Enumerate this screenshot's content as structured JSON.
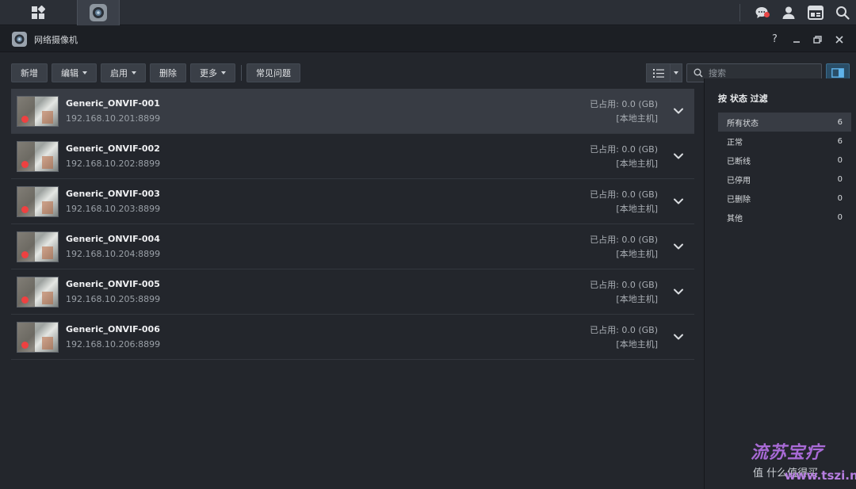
{
  "window": {
    "title": "网络摄像机"
  },
  "toolbar": {
    "add": "新增",
    "edit": "编辑",
    "enable": "启用",
    "delete": "删除",
    "more": "更多",
    "faq": "常见问题"
  },
  "search": {
    "placeholder": "搜索"
  },
  "cameras": [
    {
      "name": "Generic_ONVIF-001",
      "ip": "192.168.10.201:8899",
      "usage": "已占用:  0.0 (GB)",
      "host": "[本地主机]"
    },
    {
      "name": "Generic_ONVIF-002",
      "ip": "192.168.10.202:8899",
      "usage": "已占用:  0.0 (GB)",
      "host": "[本地主机]"
    },
    {
      "name": "Generic_ONVIF-003",
      "ip": "192.168.10.203:8899",
      "usage": "已占用:  0.0 (GB)",
      "host": "[本地主机]"
    },
    {
      "name": "Generic_ONVIF-004",
      "ip": "192.168.10.204:8899",
      "usage": "已占用:  0.0 (GB)",
      "host": "[本地主机]"
    },
    {
      "name": "Generic_ONVIF-005",
      "ip": "192.168.10.205:8899",
      "usage": "已占用:  0.0 (GB)",
      "host": "[本地主机]"
    },
    {
      "name": "Generic_ONVIF-006",
      "ip": "192.168.10.206:8899",
      "usage": "已占用:  0.0 (GB)",
      "host": "[本地主机]"
    }
  ],
  "filter": {
    "title": "按 状态 过滤",
    "items": [
      {
        "label": "所有状态",
        "count": "6"
      },
      {
        "label": "正常",
        "count": "6"
      },
      {
        "label": "已断线",
        "count": "0"
      },
      {
        "label": "已停用",
        "count": "0"
      },
      {
        "label": "已删除",
        "count": "0"
      },
      {
        "label": "其他",
        "count": "0"
      }
    ]
  },
  "watermark": {
    "text": "流苏宝疗",
    "url": "www.tszi.net",
    "sub": "值 什么值得买"
  },
  "colors": {
    "accent": "#2a4d66",
    "record": "#ee4141",
    "notify": "#e64545"
  }
}
